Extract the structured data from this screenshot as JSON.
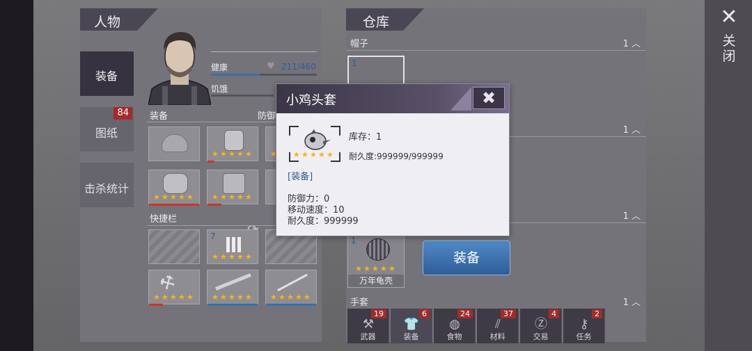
{
  "close": {
    "icon": "close-icon",
    "label": "关闭"
  },
  "character": {
    "title": "人物",
    "side_tabs": [
      {
        "label": "装备"
      },
      {
        "label": "图纸",
        "badge": "84"
      },
      {
        "label": "击杀统计"
      }
    ],
    "stats": {
      "health_label": "健康",
      "health_value": "211/460",
      "hunger_label": "饥饿"
    },
    "equipment_label": "装备",
    "defense_label": "防御",
    "quickbar_label": "快捷栏",
    "quickbar_count": "7"
  },
  "warehouse": {
    "title": "仓库",
    "sections": [
      {
        "label": "帽子",
        "count": "1"
      },
      {
        "label": "",
        "count": "1"
      },
      {
        "label": "",
        "count": "1"
      },
      {
        "label": "手套",
        "count": "1"
      }
    ],
    "hat_slot_count": "1",
    "shell_item": {
      "count": "1",
      "name": "万年龟壳"
    },
    "equip_button": "装备",
    "bottom_tabs": [
      {
        "label": "武器",
        "badge": "19",
        "icon": "axe-icon"
      },
      {
        "label": "装备",
        "badge": "6",
        "icon": "shirt-icon"
      },
      {
        "label": "食物",
        "badge": "24",
        "icon": "meat-icon"
      },
      {
        "label": "材料",
        "badge": "37",
        "icon": "wood-icon"
      },
      {
        "label": "交易",
        "badge": "4",
        "icon": "coin-icon"
      },
      {
        "label": "任务",
        "badge": "2",
        "icon": "key-icon"
      }
    ]
  },
  "popup": {
    "title": "小鸡头套",
    "close_icon": "close-icon",
    "stock": "库存：1",
    "durability": "耐久度:999999/999999",
    "equip_link": "[装备]",
    "stats": [
      "防御力：0",
      "移动速度：10",
      "耐久度：999999"
    ]
  },
  "colors": {
    "star": "#f2b51c",
    "accent_blue": "#3a6fa8",
    "badge_red": "#a52a2a"
  }
}
